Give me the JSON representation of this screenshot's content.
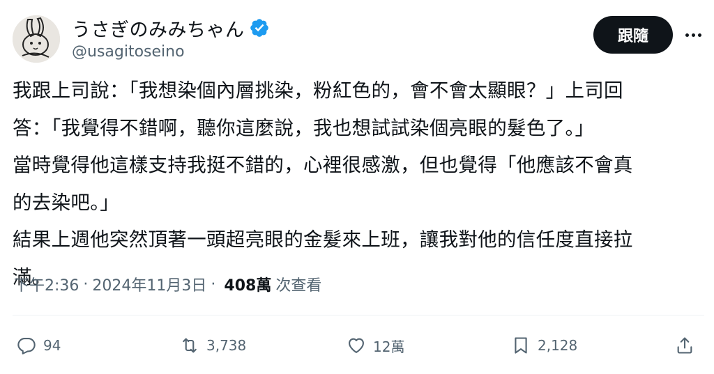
{
  "author": {
    "display_name": "うさぎのみみちゃん",
    "handle": "@usagitoseino",
    "verified": true,
    "verified_color": "#1d9bf0"
  },
  "follow_button": {
    "label": "跟隨"
  },
  "more_icon": "more-horizontal-icon",
  "tweet": {
    "lines": [
      "我跟上司說：「我想染個內層挑染，粉紅色的，會不會太顯眼？」上司回",
      "答：「我覺得不錯啊，聽你這麼說，我也想試試染個亮眼的髮色了。」",
      "當時覺得他這樣支持我挺不錯的，心裡很感激，但也覺得「他應該不會真",
      "的去染吧。」",
      "結果上週他突然頂著一頭超亮眼的金髮來上班，讓我對他的信任度直接拉",
      "滿。"
    ]
  },
  "meta": {
    "time": "下午2:36",
    "date": "2024年11月3日",
    "separator": "·",
    "views_count": "408萬",
    "views_label": "次查看"
  },
  "actions": {
    "reply": {
      "icon": "reply-icon",
      "count": "94"
    },
    "retweet": {
      "icon": "retweet-icon",
      "count": "3,738"
    },
    "like": {
      "icon": "heart-icon",
      "count": "12萬"
    },
    "bookmark": {
      "icon": "bookmark-icon",
      "count": "2,128"
    },
    "share": {
      "icon": "share-icon"
    }
  },
  "colors": {
    "text_primary": "#0f1419",
    "text_secondary": "#536471",
    "button_bg": "#0f1419"
  }
}
